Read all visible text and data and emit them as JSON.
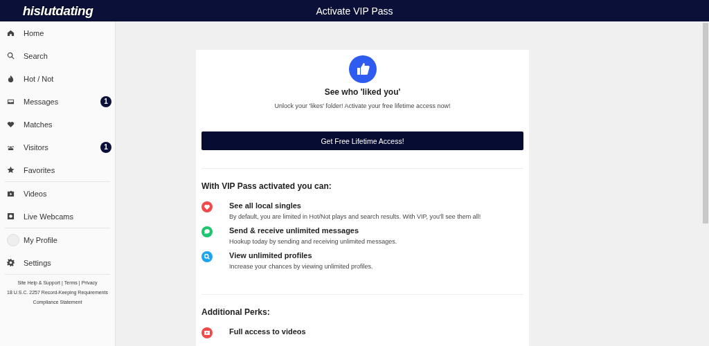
{
  "header": {
    "logo": "hislutdating",
    "title": "Activate VIP Pass"
  },
  "sidebar": {
    "items": [
      {
        "kind": "home",
        "label": "Home",
        "divider_after": false
      },
      {
        "kind": "search",
        "label": "Search",
        "divider_after": false
      },
      {
        "kind": "flame",
        "label": "Hot / Not",
        "divider_after": false
      },
      {
        "kind": "inbox",
        "label": "Messages",
        "badge": "1",
        "divider_after": false
      },
      {
        "kind": "heart",
        "label": "Matches",
        "divider_after": false
      },
      {
        "kind": "people",
        "label": "Visitors",
        "badge": "1",
        "divider_after": false
      },
      {
        "kind": "star",
        "label": "Favorites",
        "divider_after": true
      },
      {
        "kind": "video",
        "label": "Videos",
        "divider_after": false
      },
      {
        "kind": "camera",
        "label": "Live Webcams",
        "divider_after": true
      },
      {
        "kind": "avatar",
        "label": "My Profile",
        "divider_after": false
      },
      {
        "kind": "gear",
        "label": "Settings",
        "divider_after": false
      }
    ],
    "footer": {
      "links": [
        "Site Help & Support",
        "Terms",
        "Privacy"
      ],
      "separator": "|",
      "lines": [
        "18 U.S.C. 2257 Record-Keeping Requirements",
        "Compliance Statement"
      ]
    }
  },
  "card": {
    "heading": "See who 'liked you'",
    "subtitle": "Unlock your 'likes' folder! Activate your free lifetime access now!",
    "button": "Get Free Lifetime Access!",
    "sections": [
      {
        "title": "With VIP Pass activated you can:",
        "features": [
          {
            "kind": "heart",
            "color": "#f04a4a",
            "title": "See all local singles",
            "text": "By default, you are limited in Hot/Not plays and search results. With VIP, you'll see them all!"
          },
          {
            "kind": "chat",
            "color": "#1ec46f",
            "title": "Send & receive unlimited messages",
            "text": "Hookup today by sending and receiving unlimited messages."
          },
          {
            "kind": "search",
            "color": "#1aa6ee",
            "title": "View unlimited profiles",
            "text": "Increase your chances by viewing unlimited profiles."
          }
        ]
      },
      {
        "title": "Additional Perks:",
        "features": [
          {
            "kind": "video",
            "color": "#f04a4a",
            "title": "Full access to videos"
          }
        ]
      }
    ]
  }
}
